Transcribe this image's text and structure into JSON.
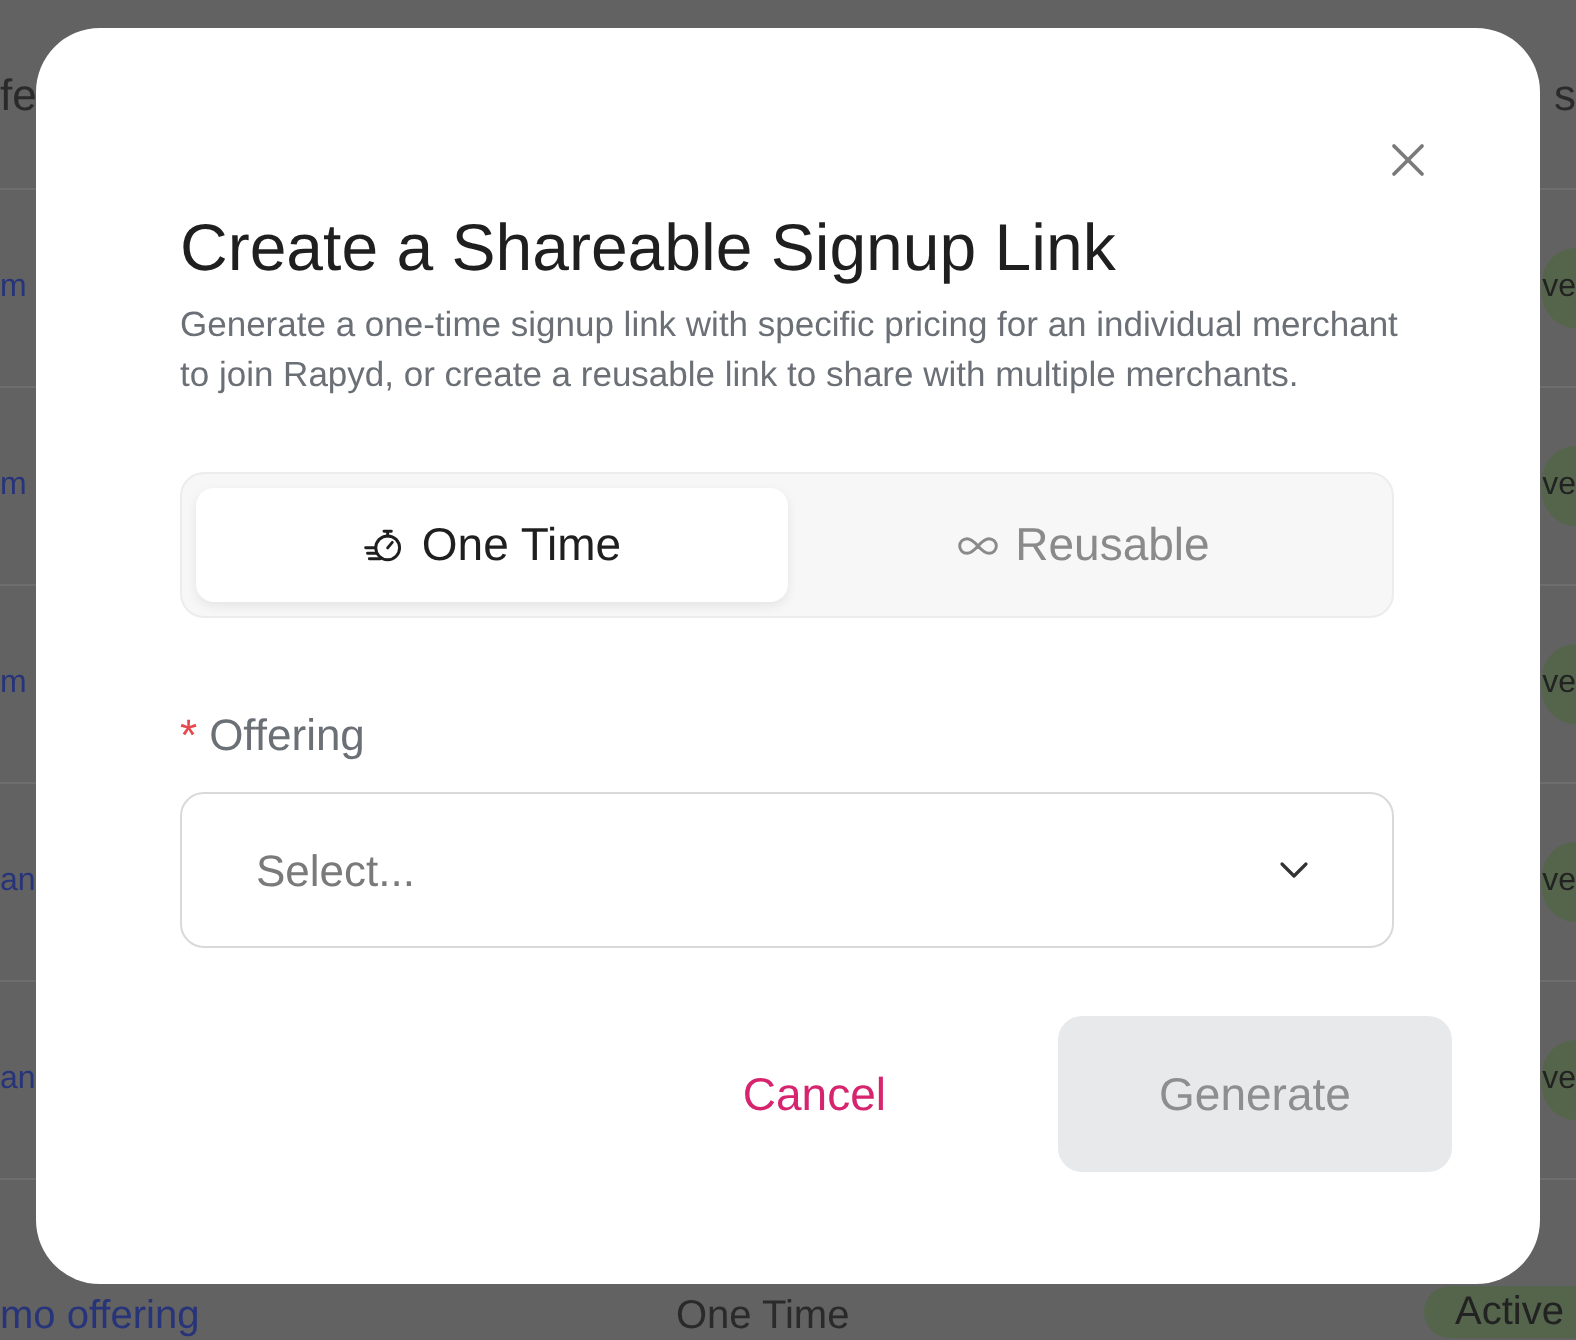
{
  "background_table": {
    "columns": [
      "fe",
      "s"
    ],
    "rows": [
      {
        "offering": "m",
        "status": "ve"
      },
      {
        "offering": "m",
        "status": "ve"
      },
      {
        "offering": "m",
        "status": "ve"
      },
      {
        "offering": "an",
        "status": "ve"
      },
      {
        "offering": "an",
        "status": "ve"
      },
      {
        "offering": "mo offering",
        "type": "One Time",
        "status": "Active"
      }
    ]
  },
  "dialog": {
    "title": "Create a Shareable Signup Link",
    "description": "Generate a one-time signup link with specific pricing for an individual merchant to join Rapyd, or create a reusable link to share with multiple merchants.",
    "tabs": [
      {
        "label": "One Time",
        "selected": true
      },
      {
        "label": "Reusable",
        "selected": false
      }
    ],
    "field": {
      "required_mark": "*",
      "label": "Offering",
      "placeholder": "Select..."
    },
    "buttons": {
      "cancel": "Cancel",
      "generate": {
        "label": "Generate",
        "disabled": true
      }
    }
  }
}
